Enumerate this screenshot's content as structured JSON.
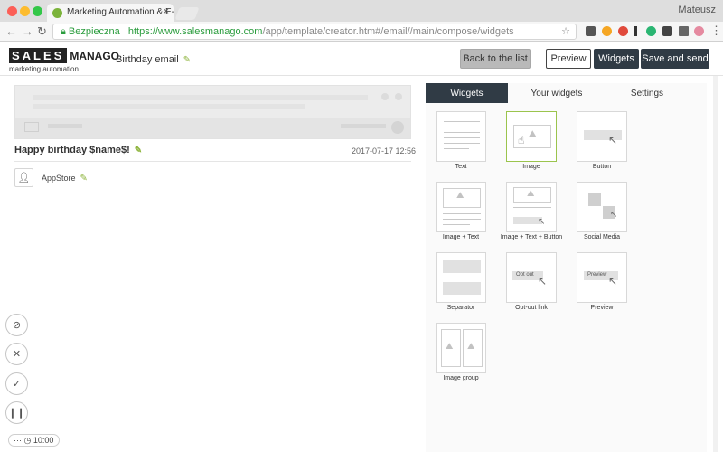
{
  "browser": {
    "tab_title": "Marketing Automation & E-Mai",
    "tab_close": "×",
    "user_name": "Mateusz",
    "back": "←",
    "forward": "→",
    "reload": "↻",
    "secure_label": "Bezpieczna",
    "url_host": "https://www.salesmanago.com",
    "url_path": "/app/template/creator.htm#/email//main/compose/widgets",
    "star": "☆"
  },
  "header": {
    "logo_main": "SALES",
    "logo_second": "MANAGO",
    "logo_sub": "marketing automation",
    "email_name": "Birthday email",
    "back_label": "Back to the list",
    "preview_label": "Preview",
    "widgets_label": "Widgets",
    "save_label": "Save and send"
  },
  "email": {
    "subject": "Happy birthday $name$!",
    "date": "2017-07-17 12:56",
    "sender": "AppStore"
  },
  "panel": {
    "tabs": [
      "Widgets",
      "Your widgets",
      "Settings"
    ],
    "widgets": [
      "Text",
      "Image",
      "Button",
      "Image + Text",
      "Image + Text + Button",
      "Social Media",
      "Separator",
      "Opt-out link",
      "Preview",
      "Image group"
    ],
    "optout_text": "Opt out",
    "preview_text": "Preview"
  },
  "controls": {
    "timer": "10:00",
    "more": "···"
  }
}
